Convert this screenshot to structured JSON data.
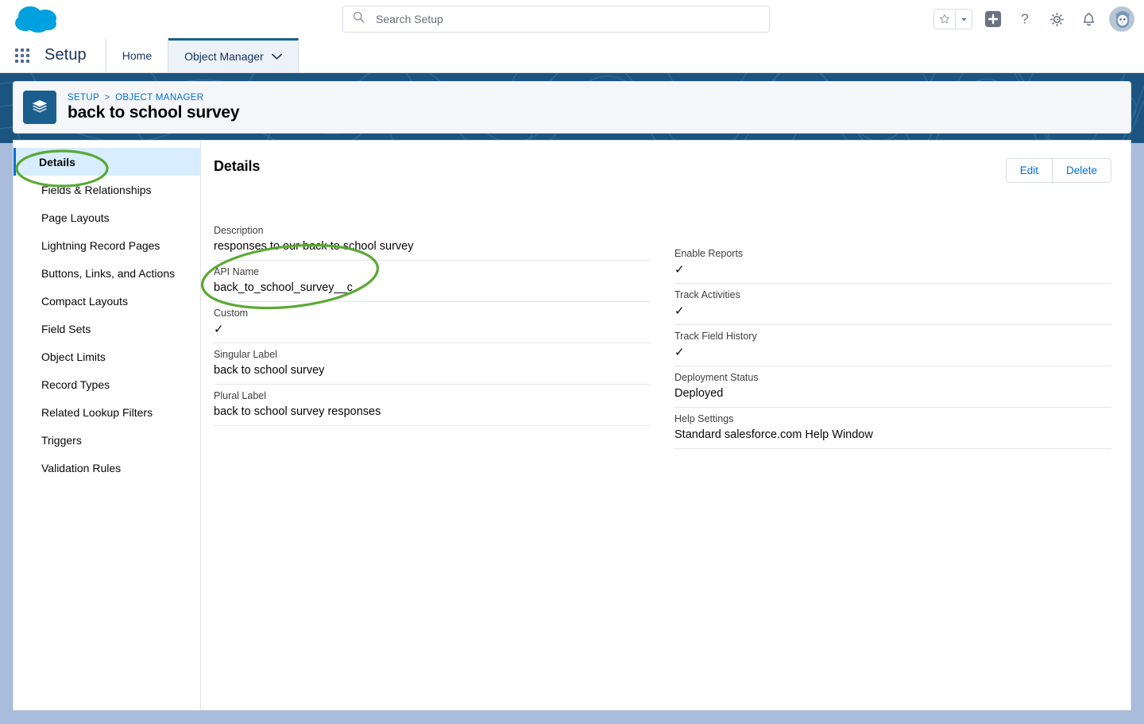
{
  "colors": {
    "brand_blue": "#00a1e0",
    "banner_blue": "#1c5480",
    "link_blue": "#0070d2",
    "active_bg": "#d8edff",
    "annotation_green": "#5aa935",
    "page_bg": "#a9bcdc"
  },
  "global_header": {
    "logo_name": "salesforce-cloud-logo",
    "search": {
      "placeholder": "Search Setup",
      "value": ""
    },
    "icons": [
      {
        "name": "favorites-star-icon",
        "glyph": "★"
      },
      {
        "name": "favorites-dropdown-icon",
        "glyph": "▾"
      },
      {
        "name": "add-icon",
        "glyph": "+"
      },
      {
        "name": "help-icon",
        "glyph": "?"
      },
      {
        "name": "setup-gear-icon",
        "glyph": "⚙"
      },
      {
        "name": "notifications-bell-icon",
        "glyph": "␇"
      },
      {
        "name": "user-avatar",
        "glyph": ""
      }
    ]
  },
  "setup_nav": {
    "app_launcher_label": "app-launcher",
    "title": "Setup",
    "tabs": [
      {
        "label": "Home",
        "active": false,
        "has_menu": false
      },
      {
        "label": "Object Manager",
        "active": true,
        "has_menu": true
      }
    ]
  },
  "page_header": {
    "icon_name": "object-stack-icon",
    "breadcrumb": {
      "items": [
        "SETUP",
        "OBJECT MANAGER"
      ],
      "separator": ">"
    },
    "title": "back to school survey"
  },
  "sidebar": {
    "items": [
      {
        "label": "Details",
        "active": true
      },
      {
        "label": "Fields & Relationships",
        "active": false
      },
      {
        "label": "Page Layouts",
        "active": false
      },
      {
        "label": "Lightning Record Pages",
        "active": false
      },
      {
        "label": "Buttons, Links, and Actions",
        "active": false
      },
      {
        "label": "Compact Layouts",
        "active": false
      },
      {
        "label": "Field Sets",
        "active": false
      },
      {
        "label": "Object Limits",
        "active": false
      },
      {
        "label": "Record Types",
        "active": false
      },
      {
        "label": "Related Lookup Filters",
        "active": false
      },
      {
        "label": "Triggers",
        "active": false
      },
      {
        "label": "Validation Rules",
        "active": false
      }
    ]
  },
  "main": {
    "heading": "Details",
    "actions": [
      {
        "label": "Edit",
        "name": "edit-button"
      },
      {
        "label": "Delete",
        "name": "delete-button"
      }
    ],
    "left_fields": [
      {
        "label": "Description",
        "value": "responses to our back to school survey",
        "type": "text"
      },
      {
        "label": "API Name",
        "value": "back_to_school_survey__c",
        "type": "text"
      },
      {
        "label": "Custom",
        "value": "✓",
        "type": "check"
      },
      {
        "label": "Singular Label",
        "value": "back to school survey",
        "type": "text"
      },
      {
        "label": "Plural Label",
        "value": "back to school survey responses",
        "type": "text"
      }
    ],
    "right_fields": [
      {
        "label": "Enable Reports",
        "value": "✓",
        "type": "check"
      },
      {
        "label": "Track Activities",
        "value": "✓",
        "type": "check"
      },
      {
        "label": "Track Field History",
        "value": "✓",
        "type": "check"
      },
      {
        "label": "Deployment Status",
        "value": "Deployed",
        "type": "text"
      },
      {
        "label": "Help Settings",
        "value": "Standard salesforce.com Help Window",
        "type": "text"
      }
    ]
  },
  "annotations": [
    {
      "name": "annotation-ellipse-details",
      "target": "Details sidebar item"
    },
    {
      "name": "annotation-ellipse-api-name",
      "target": "API Name field"
    }
  ]
}
